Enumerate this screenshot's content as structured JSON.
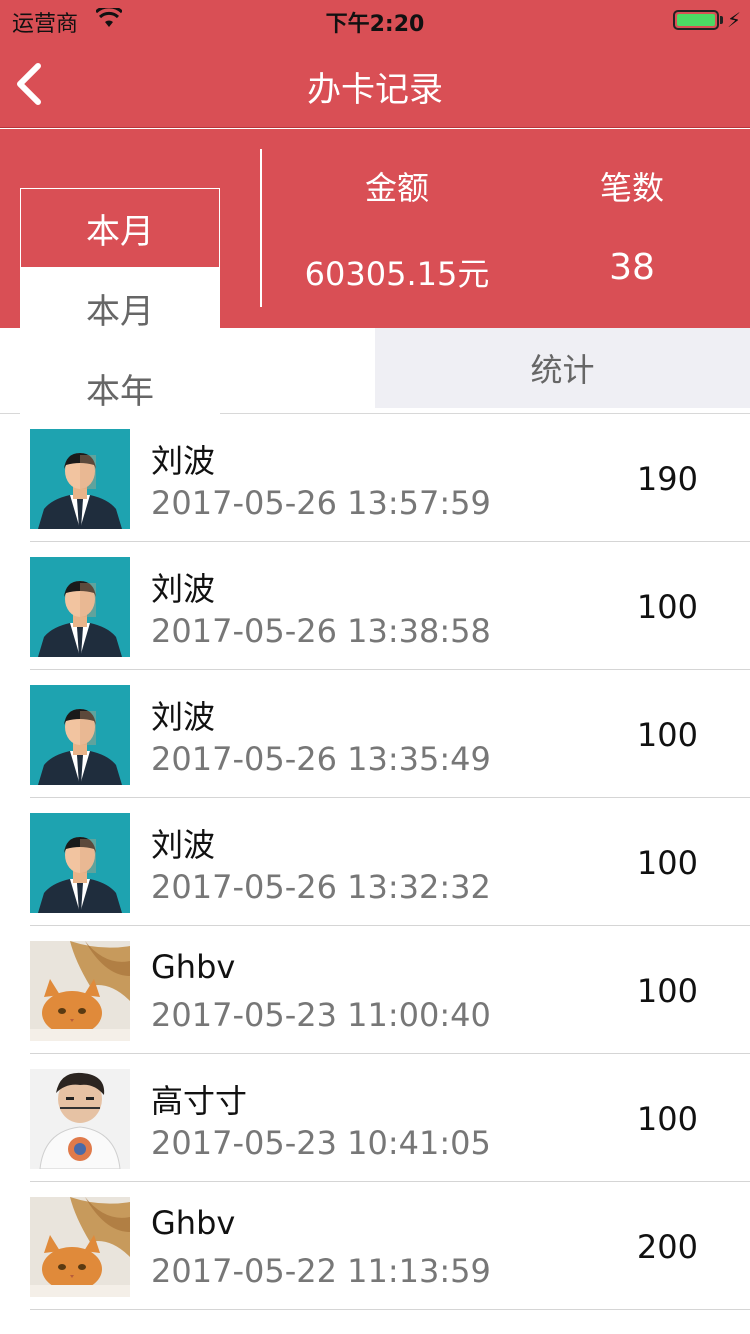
{
  "status_bar": {
    "carrier": "运营商",
    "time": "下午2:20"
  },
  "nav": {
    "title": "办卡记录"
  },
  "summary": {
    "period_selected": "本月",
    "amount_label": "金额",
    "count_label": "笔数",
    "amount_value": "60305.15元",
    "count_value": "38"
  },
  "dropdown": {
    "options": [
      "本月",
      "本年"
    ]
  },
  "tabs": {
    "stats": "统计"
  },
  "records": [
    {
      "name": "刘波",
      "time": "2017-05-26 13:57:59",
      "amount": "190",
      "avatar": "man-avatar-icon"
    },
    {
      "name": "刘波",
      "time": "2017-05-26 13:38:58",
      "amount": "100",
      "avatar": "man-avatar-icon"
    },
    {
      "name": "刘波",
      "time": "2017-05-26 13:35:49",
      "amount": "100",
      "avatar": "man-avatar-icon"
    },
    {
      "name": "刘波",
      "time": "2017-05-26 13:32:32",
      "amount": "100",
      "avatar": "man-avatar-icon"
    },
    {
      "name": "Ghbv",
      "time": "2017-05-23 11:00:40",
      "amount": "100",
      "avatar": "cat-photo"
    },
    {
      "name": "高寸寸",
      "time": "2017-05-23 10:41:05",
      "amount": "100",
      "avatar": "person-photo"
    },
    {
      "name": "Ghbv",
      "time": "2017-05-22 11:13:59",
      "amount": "200",
      "avatar": "cat-photo"
    }
  ],
  "colors": {
    "brand": "#d94f55",
    "tab_inactive_bg": "#efeff4",
    "battery": "#4cd964"
  }
}
